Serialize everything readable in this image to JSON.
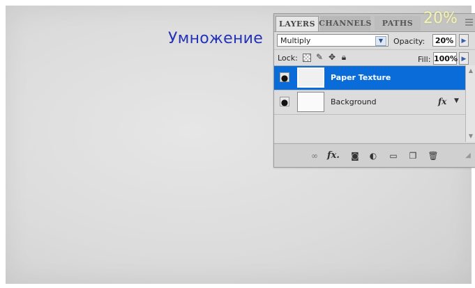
{
  "caption": "Умножение",
  "panel": {
    "tabs": [
      "LAYERS",
      "CHANNELS",
      "PATHS"
    ],
    "zoom_overlay": "20%",
    "blend_mode": "Multiply",
    "opacity_label": "Opacity:",
    "opacity_value": "20%",
    "lock_label": "Lock:",
    "fill_label": "Fill:",
    "fill_value": "100%",
    "layers": [
      {
        "name": "Paper Texture",
        "selected": true,
        "fx": ""
      },
      {
        "name": "Background",
        "selected": false,
        "fx": "fx"
      }
    ]
  },
  "toolbar": {
    "icons": [
      "link-layers-icon",
      "fx-icon",
      "layer-mask-icon",
      "adjustment-layer-icon",
      "group-folder-icon",
      "new-layer-icon",
      "trash-icon"
    ]
  },
  "colors": {
    "selection": "#0a6cd8",
    "caption": "#2432b8"
  }
}
